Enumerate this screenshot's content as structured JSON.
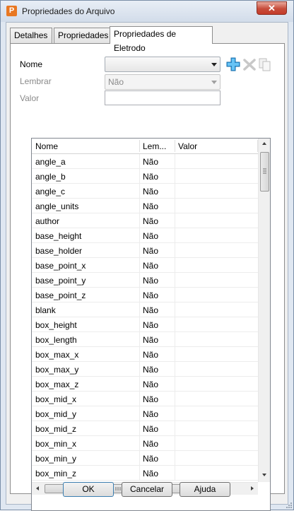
{
  "window": {
    "title": "Propriedades do Arquivo",
    "app_icon": "P",
    "close_label": "✕"
  },
  "tabs": [
    {
      "label": "Detalhes",
      "active": false
    },
    {
      "label": "Propriedades",
      "active": false
    },
    {
      "label": "Propriedades de Eletrodo",
      "active": true
    }
  ],
  "form": {
    "nome_label": "Nome",
    "nome_value": "",
    "lembrar_label": "Lembrar",
    "lembrar_value": "Não",
    "valor_label": "Valor",
    "valor_value": ""
  },
  "toolbar": {
    "add_icon": "add-plus-icon",
    "delete_icon": "delete-x-icon",
    "copy_icon": "copy-icon"
  },
  "table": {
    "columns": [
      "Nome",
      "Lem...",
      "Valor"
    ],
    "rows": [
      {
        "name": "angle_a",
        "lembrar": "Não",
        "valor": ""
      },
      {
        "name": "angle_b",
        "lembrar": "Não",
        "valor": ""
      },
      {
        "name": "angle_c",
        "lembrar": "Não",
        "valor": ""
      },
      {
        "name": "angle_units",
        "lembrar": "Não",
        "valor": ""
      },
      {
        "name": "author",
        "lembrar": "Não",
        "valor": ""
      },
      {
        "name": "base_height",
        "lembrar": "Não",
        "valor": ""
      },
      {
        "name": "base_holder",
        "lembrar": "Não",
        "valor": ""
      },
      {
        "name": "base_point_x",
        "lembrar": "Não",
        "valor": ""
      },
      {
        "name": "base_point_y",
        "lembrar": "Não",
        "valor": ""
      },
      {
        "name": "base_point_z",
        "lembrar": "Não",
        "valor": ""
      },
      {
        "name": "blank",
        "lembrar": "Não",
        "valor": ""
      },
      {
        "name": "box_height",
        "lembrar": "Não",
        "valor": ""
      },
      {
        "name": "box_length",
        "lembrar": "Não",
        "valor": ""
      },
      {
        "name": "box_max_x",
        "lembrar": "Não",
        "valor": ""
      },
      {
        "name": "box_max_y",
        "lembrar": "Não",
        "valor": ""
      },
      {
        "name": "box_max_z",
        "lembrar": "Não",
        "valor": ""
      },
      {
        "name": "box_mid_x",
        "lembrar": "Não",
        "valor": ""
      },
      {
        "name": "box_mid_y",
        "lembrar": "Não",
        "valor": ""
      },
      {
        "name": "box_mid_z",
        "lembrar": "Não",
        "valor": ""
      },
      {
        "name": "box_min_x",
        "lembrar": "Não",
        "valor": ""
      },
      {
        "name": "box_min_y",
        "lembrar": "Não",
        "valor": ""
      },
      {
        "name": "box_min_z",
        "lembrar": "Não",
        "valor": ""
      }
    ]
  },
  "buttons": {
    "ok": "OK",
    "cancel": "Cancelar",
    "help": "Ajuda"
  }
}
